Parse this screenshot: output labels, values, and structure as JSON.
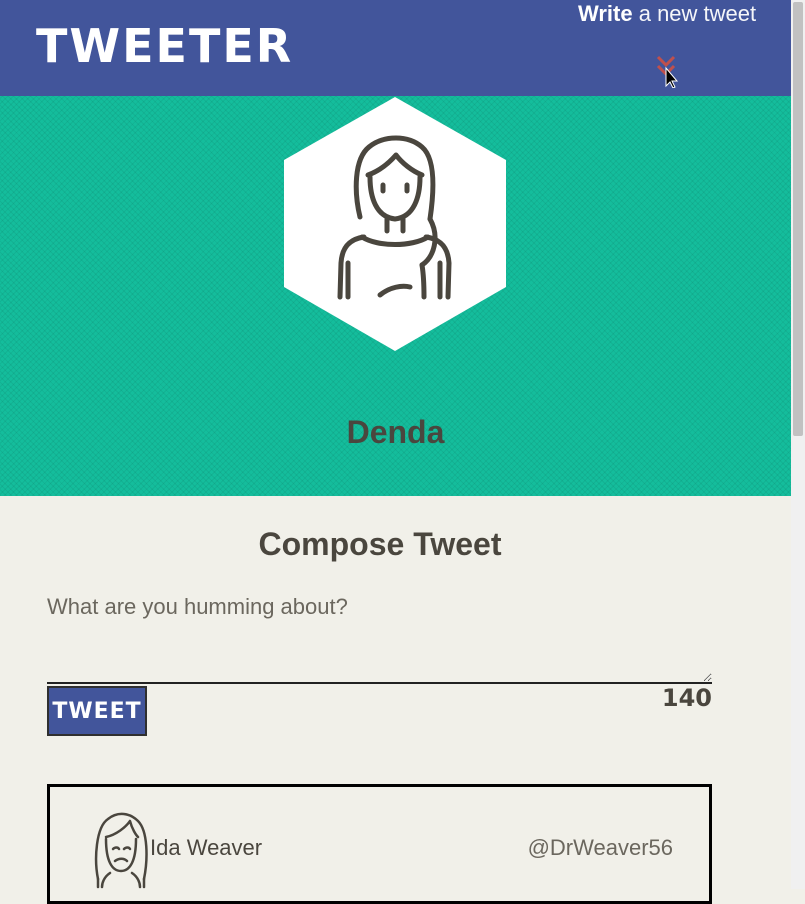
{
  "header": {
    "logo": "TWEETER",
    "compose_bold": "Write",
    "compose_rest": " a new tweet",
    "toggle_icon": "chevron-down-double-icon",
    "toggle_color": "#c0504d"
  },
  "profile": {
    "name": "Denda",
    "avatar_icon": "girl-avatar-icon",
    "banner_color": "#14bd9c"
  },
  "compose": {
    "title": "Compose Tweet",
    "placeholder": "What are you humming about?",
    "value": "",
    "button_label": "TWEET",
    "char_count": "140"
  },
  "tweets": [
    {
      "author": "Ida Weaver",
      "handle": "@DrWeaver56",
      "avatar_icon": "woman-avatar-icon"
    }
  ],
  "colors": {
    "nav": "#42559b",
    "background": "#f1f0e9",
    "text": "#4a463e"
  }
}
